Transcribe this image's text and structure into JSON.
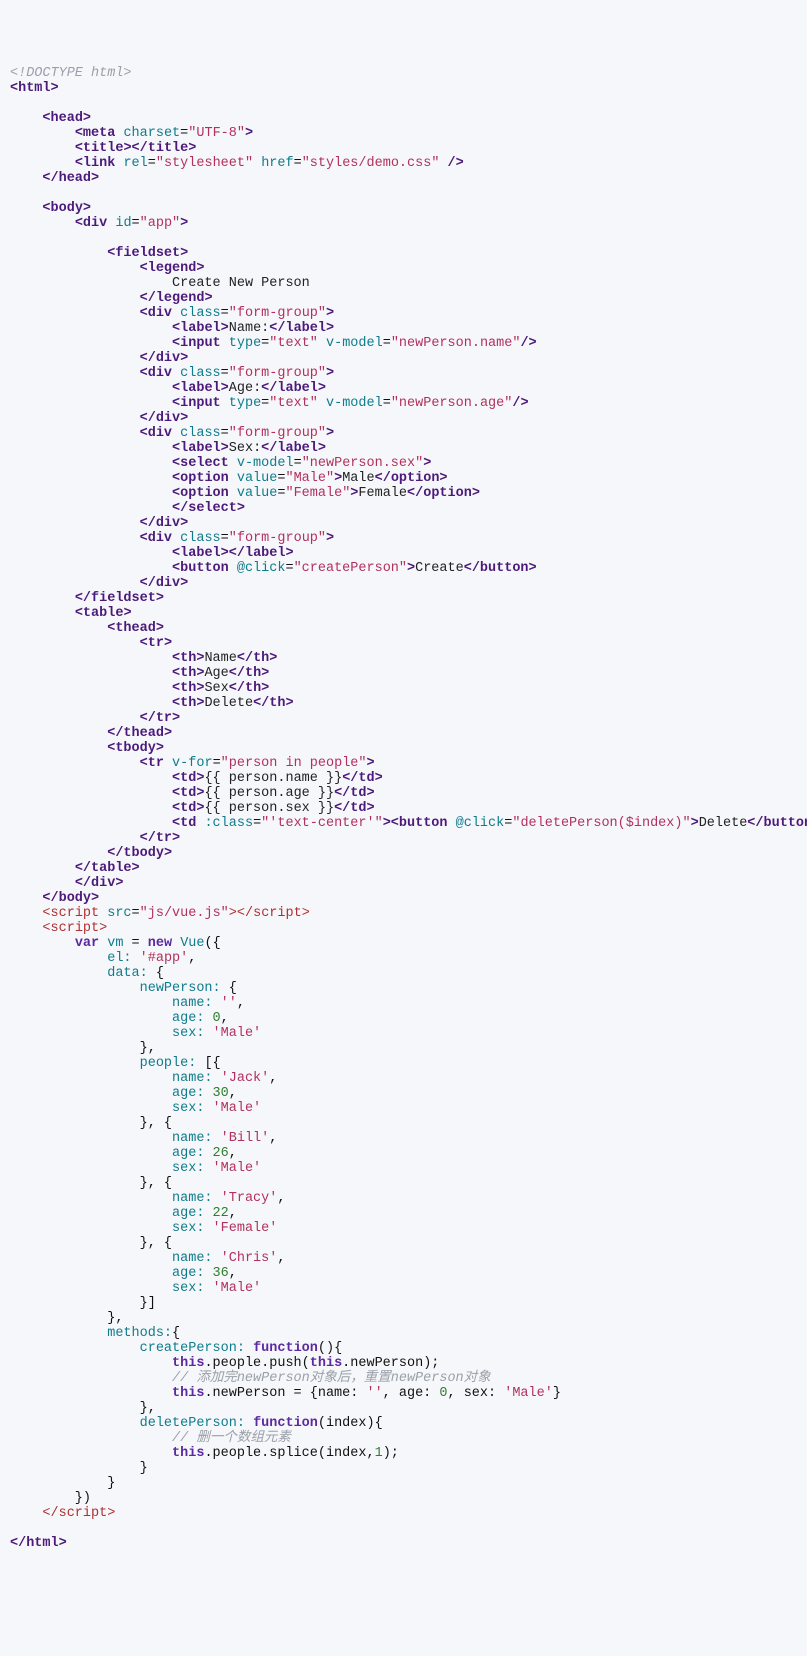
{
  "doctype": "<!DOCTYPE html>",
  "html": {
    "open": "html",
    "head": {
      "open": "head",
      "meta": {
        "tag": "meta",
        "attr1": "charset",
        "val1": "\"UTF-8\""
      },
      "title": {
        "open": "title",
        "close": "title"
      },
      "link": {
        "tag": "link",
        "attr1": "rel",
        "val1": "\"stylesheet\"",
        "attr2": "href",
        "val2": "\"styles/demo.css\""
      },
      "close": "head"
    },
    "body": {
      "open": "body",
      "div": {
        "tag": "div",
        "attr1": "id",
        "val1": "\"app\""
      },
      "close": "body"
    },
    "close": "html"
  },
  "fieldset": {
    "open": "fieldset",
    "legendOpen": "legend",
    "legendText": "Create New Person",
    "legendClose": "legend",
    "close": "fieldset"
  },
  "fg": {
    "divOpen": "div",
    "classAttr": "class",
    "classVal": "\"form-group\"",
    "labelOpen": "label",
    "labelClose": "label",
    "name": "Name:",
    "age": "Age:",
    "sex": "Sex:",
    "input": {
      "tag": "input",
      "typeAttr": "type",
      "typeVal": "\"text\"",
      "vmAttr": "v-model"
    },
    "vmName": "\"newPerson.name\"",
    "vmAge": "\"newPerson.age\"",
    "vmSex": "\"newPerson.sex\"",
    "select": "select",
    "option": "option",
    "valueAttr": "value",
    "maleVal": "\"Male\"",
    "femaleVal": "\"Female\"",
    "maleText": "Male",
    "femaleText": "Female",
    "button": "button",
    "clickAttr": "@click",
    "createVal": "\"createPerson\"",
    "createText": "Create",
    "divClose": "div"
  },
  "table": {
    "open": "table",
    "thead": "thead",
    "tr": "tr",
    "th": "th",
    "h1": "Name",
    "h2": "Age",
    "h3": "Sex",
    "h4": "Delete",
    "tbody": "tbody",
    "vforAttr": "v-for",
    "vforVal": "\"person in people\"",
    "td": "td",
    "c1": "{{ person.name }}",
    "c2": "{{ person.age }}",
    "c3": "{{ person.sex }}",
    "classAttr": ":class",
    "classVal": "\"'text-center'\"",
    "button": "button",
    "clickAttr": "@click",
    "deleteVal": "\"deletePerson($index)\"",
    "deleteText": "Delete",
    "close": "table"
  },
  "scriptTag": {
    "open": "script",
    "srcAttr": "src",
    "srcVal": "\"js/vue.js\"",
    "close": "script"
  },
  "js": {
    "var": "var",
    "vm": "vm",
    "eq": "=",
    "new": "new",
    "Vue": "Vue",
    "el": "el:",
    "elVal": "'#app'",
    "data": "data:",
    "newPerson": "newPerson:",
    "name": "name:",
    "age": "age:",
    "sex": "sex:",
    "empty": "''",
    "zero": "0",
    "male": "'Male'",
    "female": "'Female'",
    "people": "people:",
    "jack": "'Jack'",
    "bill": "'Bill'",
    "tracy": "'Tracy'",
    "chris": "'Chris'",
    "a30": "30",
    "a26": "26",
    "a22": "22",
    "a36": "36",
    "methods": "methods:",
    "createPerson": "createPerson:",
    "deletePerson": "deletePerson:",
    "function": "function",
    "this": "this",
    "push": ".people.push(",
    "np": ".newPerson",
    "resetComment": "// 添加完newPerson对象后，重置newPerson对象",
    "resetLine1": ".newPerson = {name: ",
    "resetLine2": ", age: ",
    "resetLine3": ", sex: ",
    "delComment": "// 删一个数组元素",
    "splice": ".people.splice(index,",
    "one": "1",
    "index": "index"
  }
}
